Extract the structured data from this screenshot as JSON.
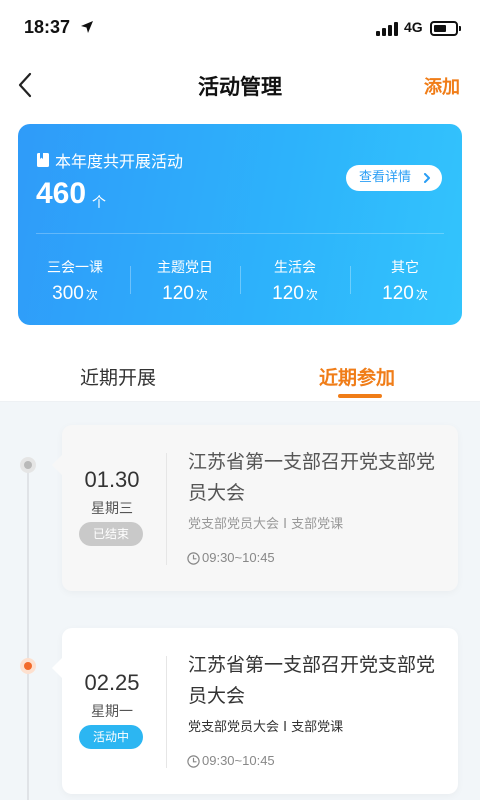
{
  "status": {
    "time": "18:37",
    "network": "4G"
  },
  "nav": {
    "title": "活动管理",
    "add_label": "添加"
  },
  "summary": {
    "title": "本年度共开展活动",
    "count": "460",
    "unit": "个",
    "detail_label": "查看详情",
    "stats": [
      {
        "label": "三会一课",
        "value": "300",
        "unit": "次"
      },
      {
        "label": "主题党日",
        "value": "120",
        "unit": "次"
      },
      {
        "label": "生活会",
        "value": "120",
        "unit": "次"
      },
      {
        "label": "其它",
        "value": "120",
        "unit": "次"
      }
    ]
  },
  "tabs": {
    "recent": "近期开展",
    "joined": "近期参加"
  },
  "activities": [
    {
      "date": "01.30",
      "weekday": "星期三",
      "status": "已结束",
      "title": "江苏省第一支部召开党支部党员大会",
      "tags": "党支部党员大会 I 支部党课",
      "time": "09:30~10:45"
    },
    {
      "date": "02.25",
      "weekday": "星期一",
      "status": "活动中",
      "title": "江苏省第一支部召开党支部党员大会",
      "tags": "党支部党员大会 I 支部党课",
      "time": "09:30~10:45"
    }
  ],
  "colors": {
    "accent": "#f07d18",
    "card_blue": "#2f9bf9",
    "active_badge": "#2cb6f2",
    "ended_badge": "#c9c9c9"
  }
}
